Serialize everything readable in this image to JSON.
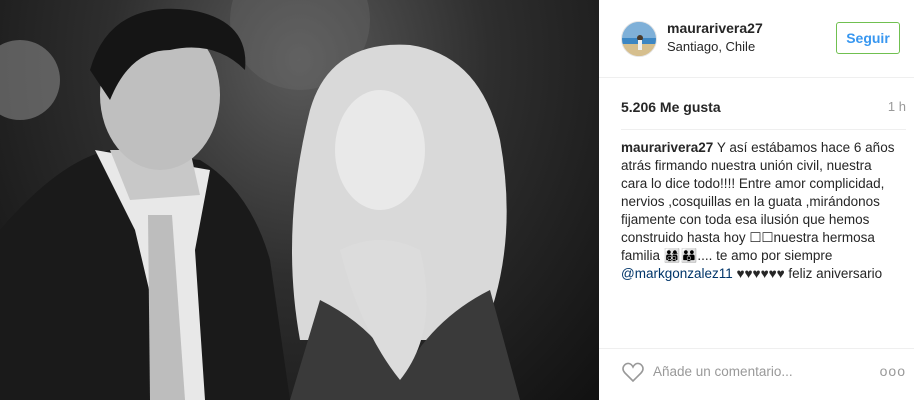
{
  "post": {
    "username": "maurarivera27",
    "location": "Santiago, Chile",
    "follow_label": "Seguir",
    "likes": "5.206 Me gusta",
    "time_ago": "1 h",
    "caption": {
      "user": "maurarivera27",
      "text_1": " Y así estábamos hace 6 años atrás firmando nuestra unión civil, nuestra cara lo dice todo!!!! Entre amor complicidad, nervios ,cosquillas en la guata ,mirándonos fijamente con toda esa ilusión que hemos construido hasta hoy ☐☐nuestra hermosa familia 👨‍👩‍👦‍👦👪.... te amo por siempre ",
      "mention": "@markgonzalez11",
      "text_2": " ♥♥♥♥♥♥ feliz aniversario"
    },
    "comment_placeholder": "Añade un comentario...",
    "more_label": "ooo"
  },
  "colors": {
    "follow_border": "#70c050",
    "follow_text": "#3897f0",
    "mention": "#003569"
  },
  "icons": {
    "like": "heart-icon",
    "options": "more-options-icon"
  }
}
